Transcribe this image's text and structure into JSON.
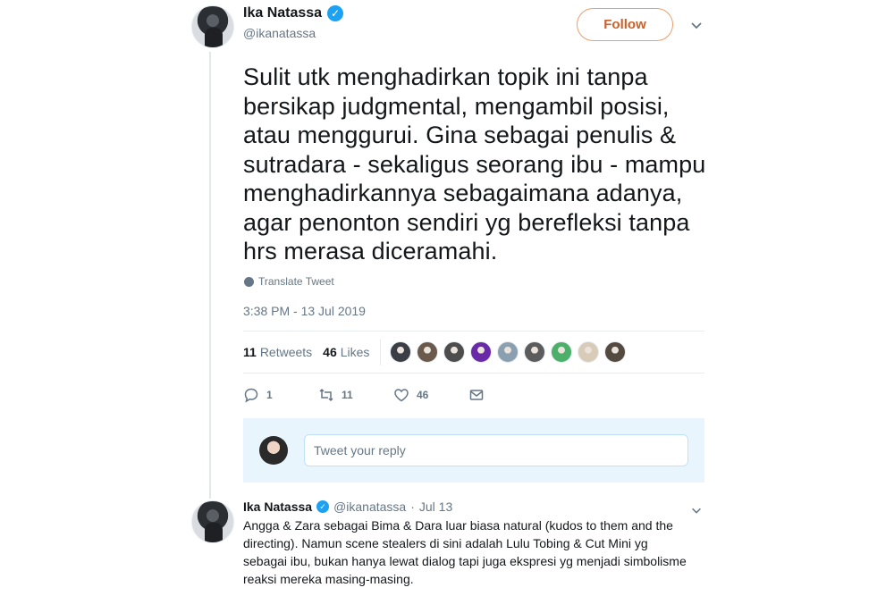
{
  "tweet": {
    "author": {
      "name": "Ika Natassa",
      "handle": "@ikanatassa",
      "verified_icon": "verified-badge-icon"
    },
    "follow_label": "Follow",
    "text": "Sulit utk menghadirkan topik ini tanpa bersikap judgmental, mengambil posisi, atau menggurui. Gina sebagai penulis & sutradara - sekaligus seorang ibu - mampu menghadirkannya sebagaimana adanya, agar penonton sendiri yg berefleksi tanpa hrs merasa diceramahi.",
    "translate_label": "Translate Tweet",
    "timestamp": "3:38 PM - 13 Jul 2019",
    "stats": {
      "retweets_count": "11",
      "retweets_label": "Retweets",
      "likes_count": "46",
      "likes_label": "Likes"
    },
    "liker_avatars": [
      "#3b3f45",
      "#6b5a4c",
      "#4d4d4d",
      "#6a2aa8",
      "#8aa0b0",
      "#5c5c5c",
      "#4caf6a",
      "#d8cbb8",
      "#554a3f"
    ],
    "actions": {
      "reply_count": "1",
      "retweet_count": "11",
      "like_count": "46"
    }
  },
  "reply_box": {
    "placeholder": "Tweet your reply"
  },
  "reply_tweet": {
    "name": "Ika Natassa",
    "handle": "@ikanatassa",
    "separator": "·",
    "date": "Jul 13",
    "text": "Angga & Zara sebagai Bima & Dara luar biasa natural (kudos to them and the directing). Namun scene stealers di sini adalah Lulu Tobing & Cut Mini yg sebagai ibu, bukan hanya lewat dialog tapi juga ekspresi yg menjadi simbolisme reaksi mereka masing-masing."
  },
  "colors": {
    "accent": "#1da1f2",
    "follow_border": "#e8a06f",
    "follow_text": "#c8612a",
    "muted": "#657786",
    "reply_bg": "#e8f5fd"
  }
}
